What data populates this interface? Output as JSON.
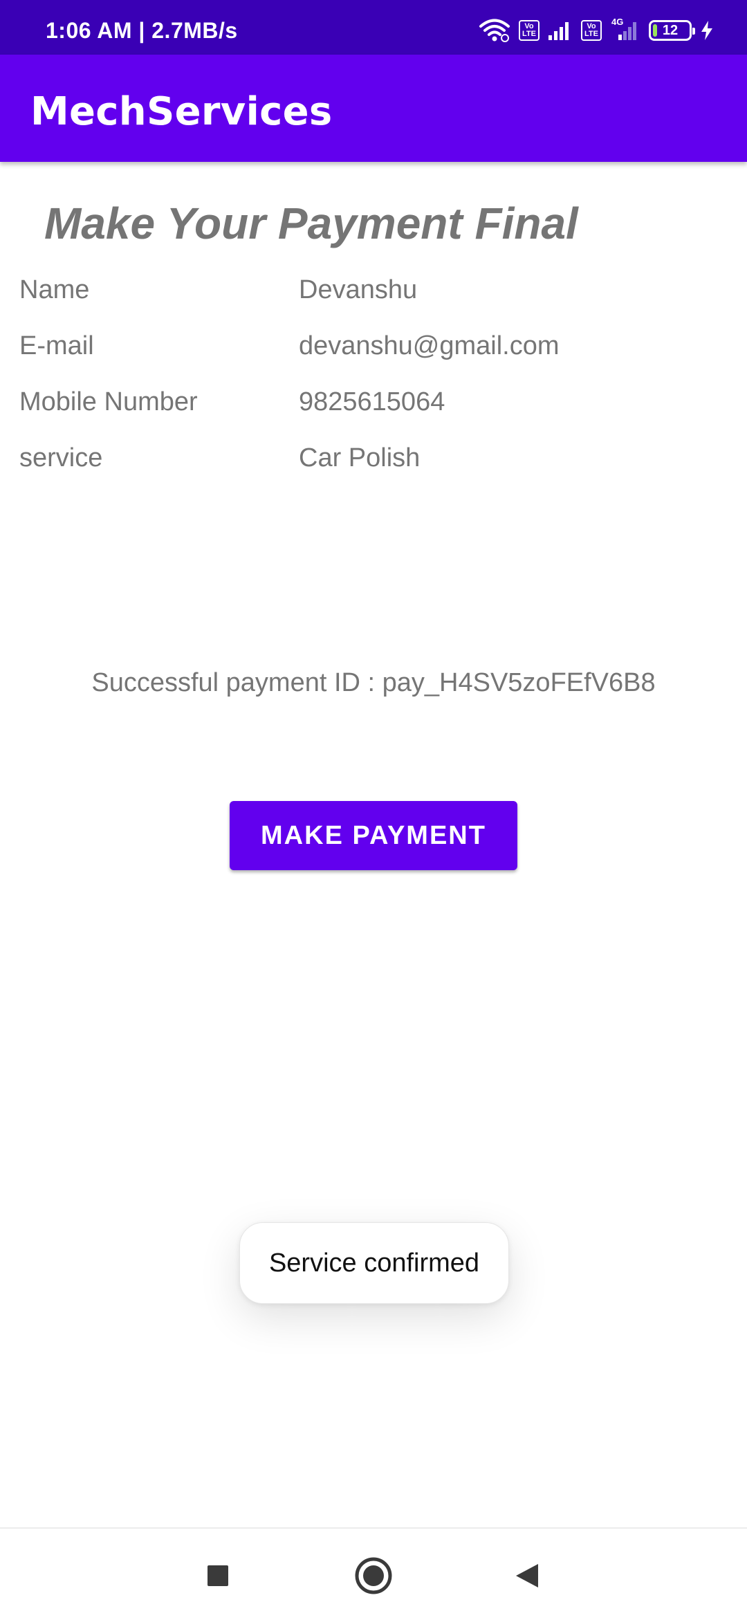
{
  "status_bar": {
    "time_speed": "1:06 AM | 2.7MB/s",
    "volte_1": [
      "Vo",
      "LTE"
    ],
    "volte_2": [
      "Vo",
      "LTE"
    ],
    "network_label": "4G",
    "battery": "12",
    "icons": [
      "wifi-icon",
      "signal-icon",
      "signal-4g-icon",
      "battery-icon",
      "charging-icon"
    ]
  },
  "app_bar": {
    "title": "MechServices"
  },
  "heading": "Make Your Payment Final",
  "details": [
    {
      "label": "Name",
      "value": "Devanshu"
    },
    {
      "label": "E-mail",
      "value": "devanshu@gmail.com"
    },
    {
      "label": "Mobile Number",
      "value": "9825615064"
    },
    {
      "label": "service",
      "value": "Car Polish"
    }
  ],
  "payment_status": "Successful payment ID : pay_H4SV5zoFEfV6B8",
  "make_payment_label": "MAKE PAYMENT",
  "toast": "Service confirmed",
  "nav_bar": {
    "icons": [
      "recents-icon",
      "home-icon",
      "back-icon"
    ]
  },
  "colors": {
    "status_bar": "#3A00B5",
    "primary": "#6200EE",
    "text_secondary": "#757575"
  }
}
